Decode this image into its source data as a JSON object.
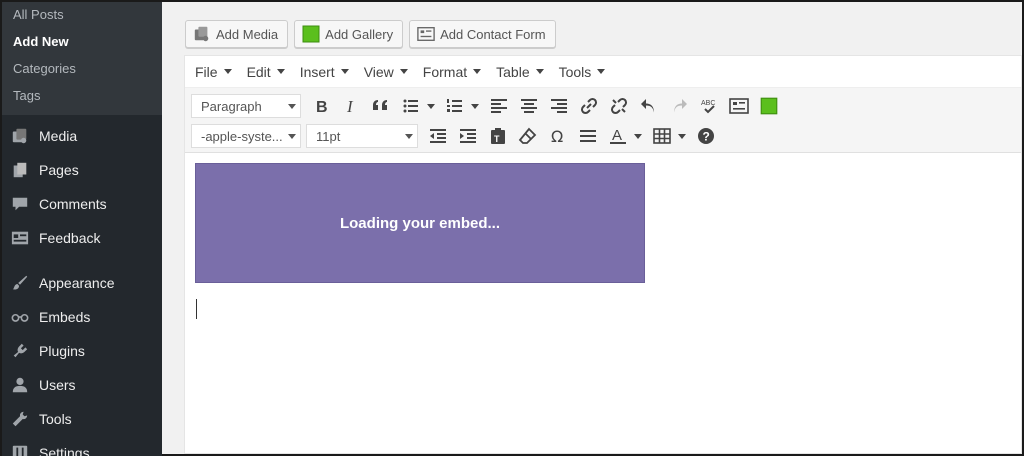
{
  "sidebar": {
    "submenu": [
      {
        "label": "All Posts",
        "current": false
      },
      {
        "label": "Add New",
        "current": true
      },
      {
        "label": "Categories",
        "current": false
      },
      {
        "label": "Tags",
        "current": false
      }
    ],
    "menu": [
      {
        "label": "Media",
        "icon": "media-icon"
      },
      {
        "label": "Pages",
        "icon": "pages-icon"
      },
      {
        "label": "Comments",
        "icon": "comments-icon"
      },
      {
        "label": "Feedback",
        "icon": "feedback-icon"
      },
      {
        "label": "Appearance",
        "icon": "paintbrush-icon"
      },
      {
        "label": "Embeds",
        "icon": "embeds-icon"
      },
      {
        "label": "Plugins",
        "icon": "plug-icon"
      },
      {
        "label": "Users",
        "icon": "user-icon"
      },
      {
        "label": "Tools",
        "icon": "wrench-icon"
      },
      {
        "label": "Settings",
        "icon": "sliders-icon"
      }
    ]
  },
  "media_buttons": {
    "add_media": "Add Media",
    "add_gallery": "Add Gallery",
    "add_contact_form": "Add Contact Form"
  },
  "menubar": [
    "File",
    "Edit",
    "Insert",
    "View",
    "Format",
    "Table",
    "Tools"
  ],
  "toolbar": {
    "format_select": "Paragraph",
    "font_family_select": "-apple-syste...",
    "font_size_select": "11pt"
  },
  "editor": {
    "embed_text": "Loading your embed..."
  },
  "colors": {
    "sidebar_bg": "#23282d",
    "submenu_bg": "#32373c",
    "embed_bg": "#7b6fab",
    "gallery_green": "#5bbf1d"
  }
}
